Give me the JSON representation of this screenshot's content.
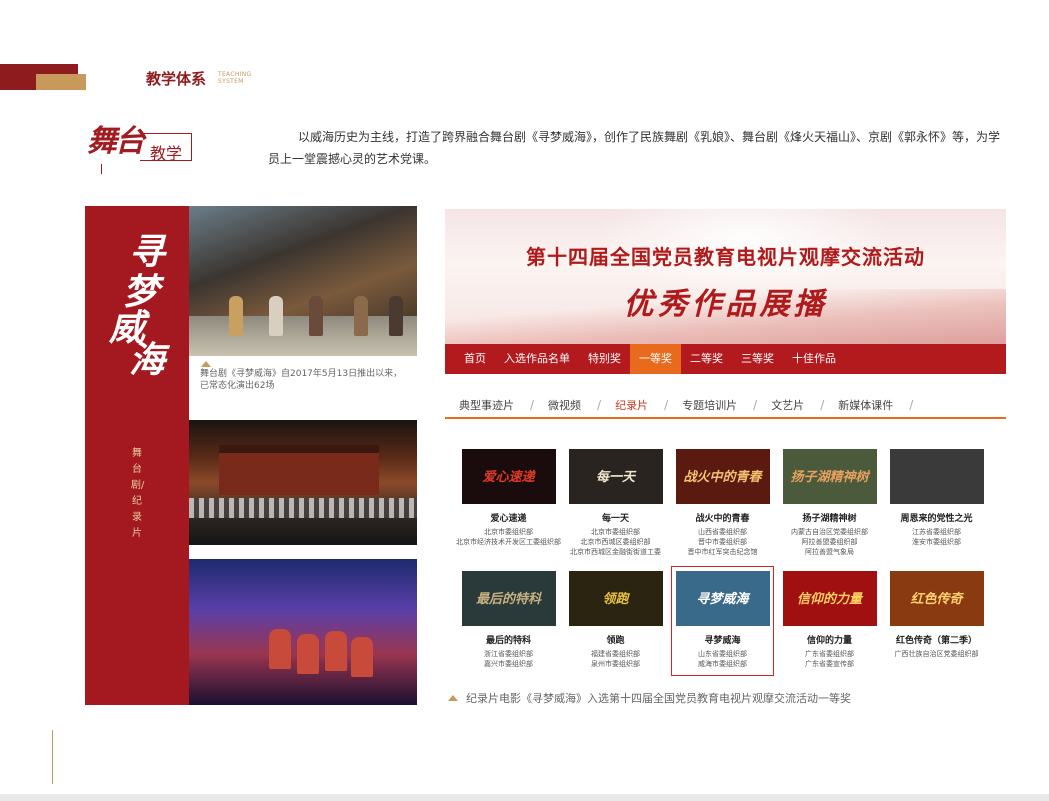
{
  "header": {
    "title": "教学体系",
    "en_line1": "TEACHING",
    "en_line2": "SYSTEM"
  },
  "section": {
    "badge_big": "舞台",
    "badge_small": "教学",
    "intro": "以威海历史为主线，打造了跨界融合舞台剧《寻梦威海》，创作了民族舞剧《乳娘》、舞台剧《烽火天福山》、京剧《郭永怀》等，为学员上一堂震撼心灵的艺术党课。"
  },
  "left": {
    "title_chars": [
      "寻",
      "梦",
      "威",
      "海"
    ],
    "subtitle": "舞台剧/纪录片",
    "caption1": "舞台剧《寻梦威海》自2017年5月13日推出以来，已常态化演出62场"
  },
  "website": {
    "banner_title": "第十四届全国党员教育电视片观摩交流活动",
    "banner_sub": "优秀作品展播",
    "nav": [
      "首页",
      "入选作品名单",
      "特别奖",
      "一等奖",
      "二等奖",
      "三等奖",
      "十佳作品"
    ],
    "nav_active": 3,
    "subnav": [
      "典型事迹片",
      "微视频",
      "纪录片",
      "专题培训片",
      "文艺片",
      "新媒体课件"
    ],
    "subnav_active": 2,
    "works": [
      {
        "title": "爱心速递",
        "orgs": [
          "北京市委组织部",
          "北京市经济技术开发区工委组织部"
        ],
        "thumb": "爱心速递",
        "bg": "#1a0c0c",
        "fg": "#e03a2a"
      },
      {
        "title": "每一天",
        "orgs": [
          "北京市委组织部",
          "北京市西城区委组织部",
          "北京市西城区金融街街道工委"
        ],
        "thumb": "每一天",
        "bg": "#2a2420",
        "fg": "#f0e6d0"
      },
      {
        "title": "战火中的青春",
        "orgs": [
          "山西省委组织部",
          "晋中市委组织部",
          "晋中市红军突击纪念馆"
        ],
        "thumb": "战火中的青春",
        "bg": "#5a1a10",
        "fg": "#f5c070"
      },
      {
        "title": "扬子湖精神树",
        "orgs": [
          "内蒙古自治区党委组织部",
          "阿拉善盟委组织部",
          "阿拉善盟气象局"
        ],
        "thumb": "扬子湖精神树",
        "bg": "#4a5a3a",
        "fg": "#e8a060"
      },
      {
        "title": "周恩来的党性之光",
        "orgs": [
          "江苏省委组织部",
          "淮安市委组织部"
        ],
        "thumb": "",
        "bg": "#3a3a3a",
        "fg": "#ddd"
      },
      {
        "title": "最后的特科",
        "orgs": [
          "浙江省委组织部",
          "嘉兴市委组织部"
        ],
        "thumb": "最后的特科",
        "bg": "#2a3a3a",
        "fg": "#c8b080"
      },
      {
        "title": "领跑",
        "orgs": [
          "福建省委组织部",
          "泉州市委组织部"
        ],
        "thumb": "领跑",
        "bg": "#2a2410",
        "fg": "#e8c040"
      },
      {
        "title": "寻梦威海",
        "orgs": [
          "山东省委组织部",
          "威海市委组织部"
        ],
        "thumb": "寻梦威海",
        "bg": "#3a6a8a",
        "fg": "#ffffff"
      },
      {
        "title": "信仰的力量",
        "orgs": [
          "广东省委组织部",
          "广东省委宣传部"
        ],
        "thumb": "信仰的力量",
        "bg": "#a01010",
        "fg": "#ffd060"
      },
      {
        "title": "红色传奇（第二季）",
        "orgs": [
          "广西壮族自治区党委组织部"
        ],
        "thumb": "红色传奇",
        "bg": "#8a3a10",
        "fg": "#ffd070"
      }
    ],
    "selected_index": 7
  },
  "footer_caption": "纪录片电影《寻梦威海》入选第十四届全国党员教育电视片观摩交流活动一等奖",
  "colors": {
    "brand_red": "#a3191f",
    "gold": "#c79a5c",
    "nav_active": "#e86a1d"
  }
}
